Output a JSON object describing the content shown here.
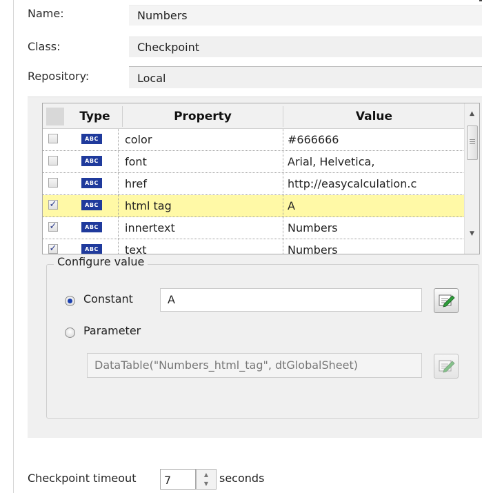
{
  "header": {
    "name_label": "Name:",
    "name_value": "Numbers",
    "class_label": "Class:",
    "class_value": "Checkpoint",
    "repository_label": "Repository:",
    "repository_value": "Local"
  },
  "grid": {
    "columns": {
      "type": "Type",
      "property": "Property",
      "value": "Value"
    },
    "rows": [
      {
        "checked": false,
        "type_icon": "ABC",
        "property": "color",
        "value": "#666666",
        "selected": false
      },
      {
        "checked": false,
        "type_icon": "ABC",
        "property": "font",
        "value": "Arial, Helvetica,",
        "selected": false
      },
      {
        "checked": false,
        "type_icon": "ABC",
        "property": "href",
        "value": "http://easycalculation.c",
        "selected": false
      },
      {
        "checked": true,
        "type_icon": "ABC",
        "property": "html tag",
        "value": "A",
        "selected": true
      },
      {
        "checked": true,
        "type_icon": "ABC",
        "property": "innertext",
        "value": "Numbers",
        "selected": false
      },
      {
        "checked": true,
        "type_icon": "ABC",
        "property": "text",
        "value": "Numbers",
        "selected": false
      }
    ]
  },
  "configure": {
    "legend": "Configure value",
    "constant_label": "Constant",
    "constant_value": "A",
    "constant_selected": true,
    "parameter_label": "Parameter",
    "parameter_value": "DataTable(\"Numbers_html_tag\", dtGlobalSheet)",
    "parameter_selected": false
  },
  "timeout": {
    "label": "Checkpoint timeout",
    "value": "7",
    "unit": "seconds"
  },
  "colors": {
    "selected_row": "#fff9a6",
    "type_badge": "#1f3a9c",
    "radio_dot": "#1a3fae"
  }
}
